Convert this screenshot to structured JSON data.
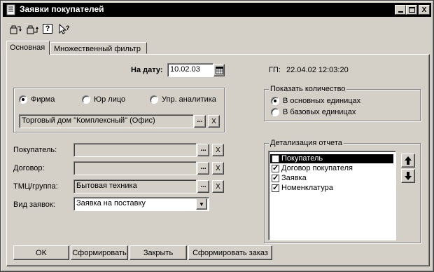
{
  "window": {
    "title": "Заявки покупателей",
    "controls": [
      "minimize",
      "maximize",
      "close"
    ]
  },
  "toolbar": {
    "icons": [
      "open-icon",
      "save-icon",
      "help-icon",
      "context-help-icon"
    ]
  },
  "tabs": [
    {
      "label": "Основная",
      "active": true
    },
    {
      "label": "Множественный фильтр",
      "active": false
    }
  ],
  "date": {
    "label": "На дату:",
    "value": "10.02.03"
  },
  "gp": {
    "label": "ГП:",
    "value": "22.04.02 12:03:20"
  },
  "entity_type": {
    "options": [
      "Фирма",
      "Юр лицо",
      "Упр. аналитика"
    ],
    "selected": "Фирма",
    "value": "Торговый дом \"Комплексный\" (Офис)"
  },
  "filters": [
    {
      "label": "Покупатель:",
      "value": ""
    },
    {
      "label": "Договор:",
      "value": ""
    },
    {
      "label": "ТМЦ/группа:",
      "value": "Бытовая техника"
    }
  ],
  "order_type": {
    "label": "Вид заявок:",
    "value": "Заявка на поставку"
  },
  "show_quantity": {
    "title": "Показать количество",
    "options": [
      "В основных единицах",
      "В базовых единицах"
    ],
    "selected": "В основных единицах"
  },
  "detail": {
    "title": "Детализация отчета",
    "items": [
      {
        "label": "Покупатель",
        "checked": false,
        "selected": true
      },
      {
        "label": "Договор покупателя",
        "checked": true,
        "selected": false
      },
      {
        "label": "Заявка",
        "checked": true,
        "selected": false
      },
      {
        "label": "Номенклатура",
        "checked": true,
        "selected": false
      }
    ]
  },
  "buttons": {
    "ok": "OK",
    "generate": "Сформировать",
    "close": "Закрыть",
    "generate_order": "Сформировать заказ"
  },
  "glyphs": {
    "ellipsis": "...",
    "clear": "X",
    "minimize": "_",
    "close": "X",
    "dropdown": "▼",
    "up": "▲",
    "down": "▼",
    "question": "?"
  }
}
